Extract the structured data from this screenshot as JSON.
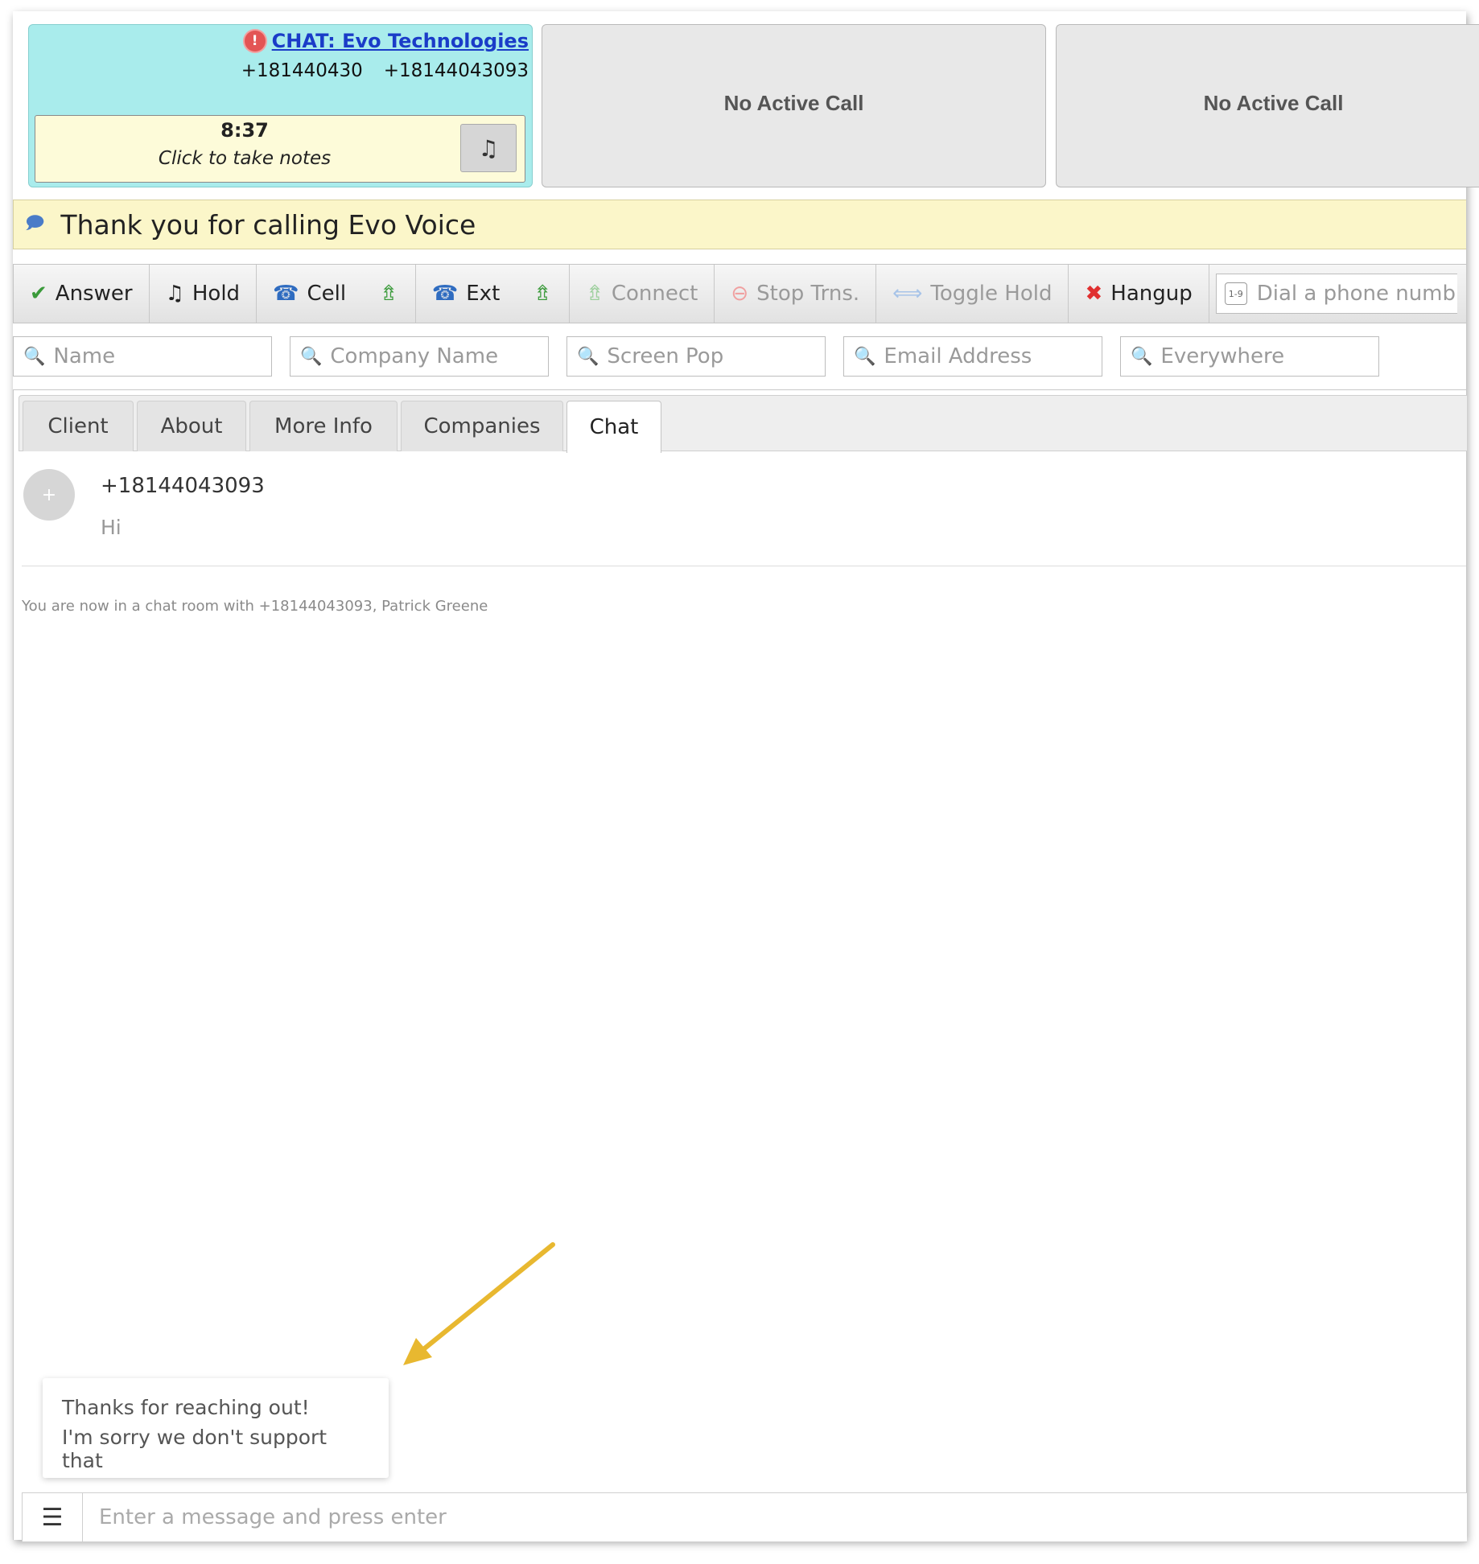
{
  "call_panels": {
    "active": {
      "title": "CHAT: Evo Technologies",
      "number_from": "+181440430",
      "number_to": "+18144043093",
      "timer": "8:37",
      "notes_hint": "Click to take notes",
      "alert_icon": "alert-icon",
      "music_icon": "music-note-icon"
    },
    "panel_2": {
      "label": "No Active Call"
    },
    "panel_3": {
      "label": "No Active Call"
    }
  },
  "greeting": {
    "icon": "speech-bubble-icon",
    "text": "Thank you for calling Evo Voice"
  },
  "toolbar": {
    "answer": "Answer",
    "hold": "Hold",
    "cell": "Cell",
    "ext": "Ext",
    "connect": "Connect",
    "stop_transfer": "Stop Trns.",
    "toggle_hold": "Toggle Hold",
    "hangup": "Hangup",
    "dial_placeholder": "Dial a phone numb"
  },
  "search": {
    "name": "Name",
    "company": "Company Name",
    "screen_pop": "Screen Pop",
    "email": "Email Address",
    "everywhere": "Everywhere"
  },
  "tabs": [
    {
      "label": "Client"
    },
    {
      "label": "About"
    },
    {
      "label": "More Info"
    },
    {
      "label": "Companies"
    },
    {
      "label": "Chat",
      "active": true
    }
  ],
  "chat": {
    "avatar_symbol": "+",
    "message": {
      "from": "+18144043093",
      "text": "Hi"
    },
    "room_notice": "You are now in a chat room with +18144043093, Patrick Greene",
    "quick_replies": [
      "Thanks for reaching out!",
      "I'm sorry we don't support that"
    ],
    "composer_placeholder": "Enter a message and press enter",
    "template_icon": "list-icon"
  },
  "colors": {
    "active_panel": "#a9ecec",
    "inactive_panel": "#e8e8e8",
    "greeting_bar": "#fbf6c9",
    "notes_box": "#fdfbd9",
    "link": "#1a3cc8",
    "annotation_arrow": "#e8b830"
  }
}
